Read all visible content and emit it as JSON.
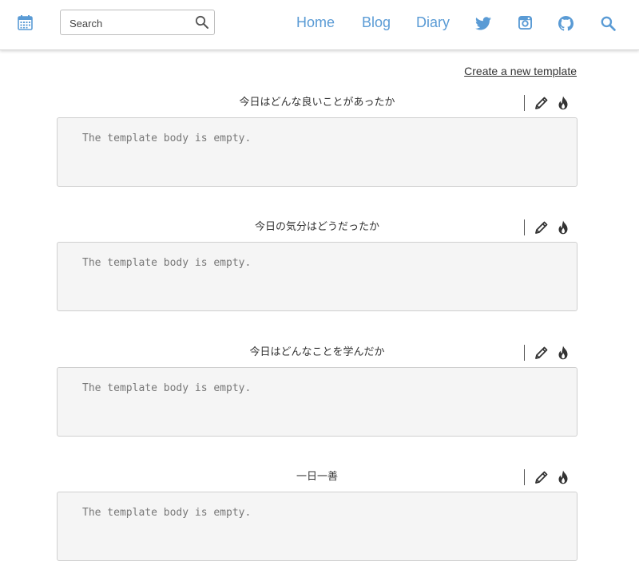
{
  "header": {
    "calendar_icon": "calendar-icon",
    "search": {
      "placeholder": "Search",
      "value": "",
      "icon": "search-icon"
    },
    "nav": [
      {
        "label": "Home"
      },
      {
        "label": "Blog"
      },
      {
        "label": "Diary"
      }
    ],
    "social_icons": [
      "twitter-icon",
      "instagram-icon",
      "github-icon",
      "search-icon"
    ],
    "accent_color": "#5a9bd5"
  },
  "main": {
    "create_link": "Create a new template",
    "templates": [
      {
        "title": "今日はどんな良いことがあったか",
        "body": "The template body is empty."
      },
      {
        "title": "今日の気分はどうだったか",
        "body": "The template body is empty."
      },
      {
        "title": "今日はどんなことを学んだか",
        "body": "The template body is empty."
      },
      {
        "title": "一日一善",
        "body": "The template body is empty."
      }
    ],
    "card_icons": [
      "pencil-icon",
      "fire-icon"
    ]
  }
}
